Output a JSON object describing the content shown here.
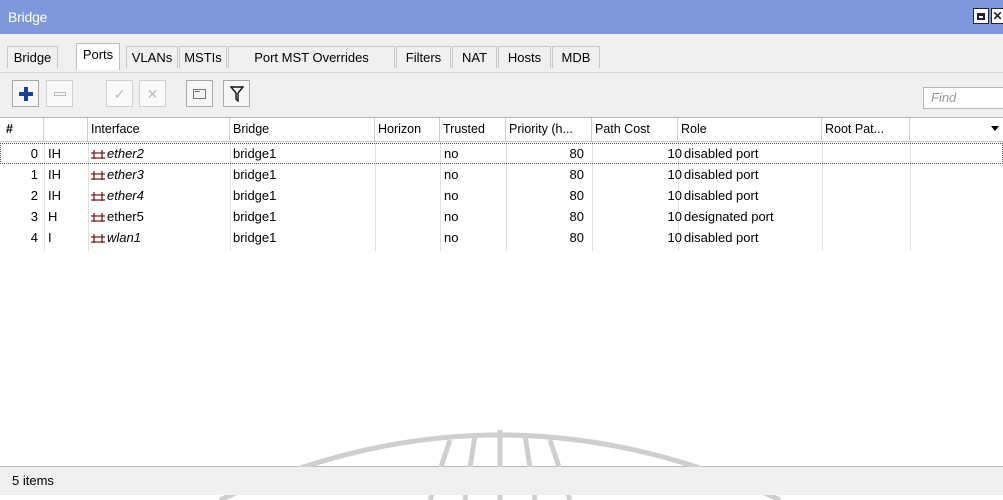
{
  "window": {
    "title": "Bridge"
  },
  "tabs": [
    {
      "label": "Bridge",
      "active": false
    },
    {
      "label": "Ports",
      "active": true
    },
    {
      "label": "VLANs",
      "active": false
    },
    {
      "label": "MSTIs",
      "active": false
    },
    {
      "label": "Port MST Overrides",
      "active": false
    },
    {
      "label": "Filters",
      "active": false
    },
    {
      "label": "NAT",
      "active": false
    },
    {
      "label": "Hosts",
      "active": false
    },
    {
      "label": "MDB",
      "active": false
    }
  ],
  "toolbar": {
    "add_icon": "plus-icon",
    "remove_icon": "minus-icon",
    "enable_icon": "check-icon",
    "disable_icon": "x-icon",
    "comment_icon": "comment-icon",
    "filter_icon": "filter-icon",
    "find_placeholder": "Find"
  },
  "table": {
    "columns": [
      "#",
      "",
      "Interface",
      "Bridge",
      "Horizon",
      "Trusted",
      "Priority (h...",
      "Path Cost",
      "Role",
      "Root Pat...",
      ""
    ],
    "rows": [
      {
        "num": "0",
        "flags": "IH",
        "interface": "ether2",
        "italic": true,
        "bridge": "bridge1",
        "horizon": "",
        "trusted": "no",
        "priority": "80",
        "path_cost": "10",
        "role": "disabled port",
        "root_path": ""
      },
      {
        "num": "1",
        "flags": "IH",
        "interface": "ether3",
        "italic": true,
        "bridge": "bridge1",
        "horizon": "",
        "trusted": "no",
        "priority": "80",
        "path_cost": "10",
        "role": "disabled port",
        "root_path": ""
      },
      {
        "num": "2",
        "flags": "IH",
        "interface": "ether4",
        "italic": true,
        "bridge": "bridge1",
        "horizon": "",
        "trusted": "no",
        "priority": "80",
        "path_cost": "10",
        "role": "disabled port",
        "root_path": ""
      },
      {
        "num": "3",
        "flags": "H",
        "interface": "ether5",
        "italic": false,
        "bridge": "bridge1",
        "horizon": "",
        "trusted": "no",
        "priority": "80",
        "path_cost": "10",
        "role": "designated port",
        "root_path": ""
      },
      {
        "num": "4",
        "flags": "I",
        "interface": "wlan1",
        "italic": true,
        "bridge": "bridge1",
        "horizon": "",
        "trusted": "no",
        "priority": "80",
        "path_cost": "10",
        "role": "disabled port",
        "root_path": ""
      }
    ],
    "interface_icon": "bridge-port-icon",
    "column_menu_icon": "chevron-down-icon"
  },
  "status": {
    "count": "5 items"
  },
  "colors": {
    "titlebar": "#7f98dc",
    "accent_icon": "#1a3e9b",
    "interface_icon": "#7a1d1d"
  }
}
